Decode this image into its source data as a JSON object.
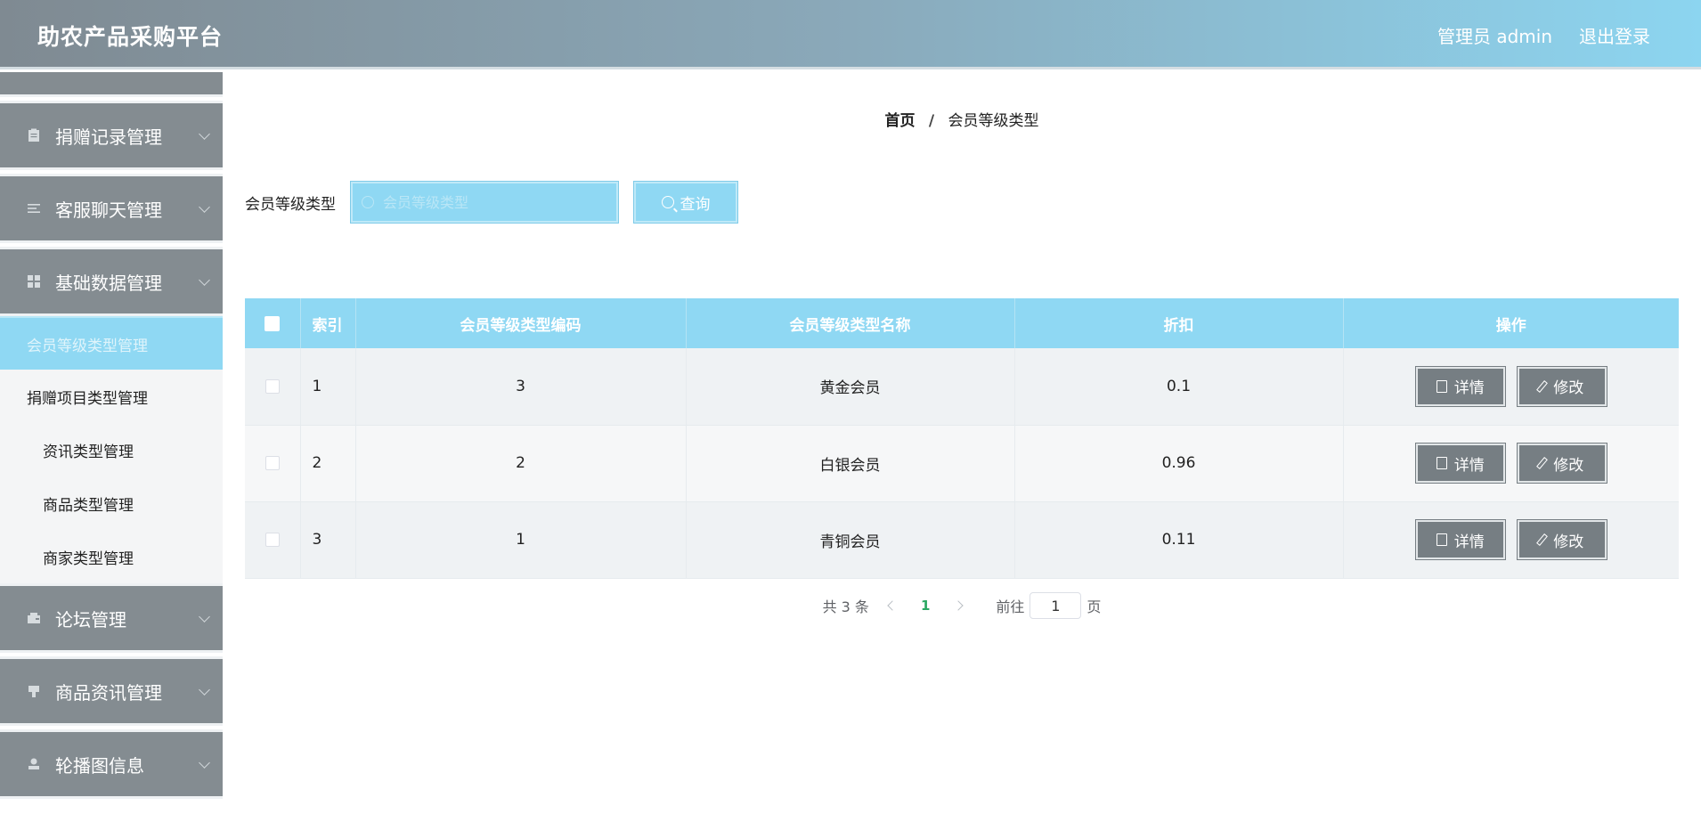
{
  "header": {
    "app_title": "助农产品采购平台",
    "user_label": "管理员 admin",
    "logout_label": "退出登录"
  },
  "sidebar": {
    "groups_top": [
      {
        "label": "捐赠记录管理",
        "icon": "clipboard-icon"
      },
      {
        "label": "客服聊天管理",
        "icon": "list-icon"
      },
      {
        "label": "基础数据管理",
        "icon": "grid-icon"
      }
    ],
    "submenu": [
      {
        "label": "会员等级类型管理",
        "active": true
      },
      {
        "label": "捐赠项目类型管理",
        "active": false
      },
      {
        "label": "资讯类型管理",
        "active": false
      },
      {
        "label": "商品类型管理",
        "active": false
      },
      {
        "label": "商家类型管理",
        "active": false
      }
    ],
    "groups_bottom": [
      {
        "label": "论坛管理",
        "icon": "wallet-icon"
      },
      {
        "label": "商品资讯管理",
        "icon": "pin-icon"
      },
      {
        "label": "轮播图信息",
        "icon": "stamp-icon"
      }
    ]
  },
  "breadcrumb": {
    "home": "首页",
    "separator": "/",
    "current": "会员等级类型"
  },
  "search": {
    "label": "会员等级类型",
    "placeholder": "会员等级类型",
    "value": "",
    "button_label": "查询"
  },
  "table": {
    "columns": [
      "索引",
      "会员等级类型编码",
      "会员等级类型名称",
      "折扣",
      "操作"
    ],
    "rows": [
      {
        "index": "1",
        "code": "3",
        "name": "黄金会员",
        "discount": "0.1"
      },
      {
        "index": "2",
        "code": "2",
        "name": "白银会员",
        "discount": "0.96"
      },
      {
        "index": "3",
        "code": "1",
        "name": "青铜会员",
        "discount": "0.11"
      }
    ],
    "detail_label": "详情",
    "edit_label": "修改"
  },
  "pagination": {
    "total_text": "共 3 条",
    "current_page": "1",
    "goto_prefix": "前往",
    "goto_value": "1",
    "goto_suffix": "页"
  },
  "colors": {
    "accent": "#8fd8f3",
    "sidebar_bg": "#848c91",
    "action_button": "#767e83",
    "active_page": "#2aa862"
  }
}
